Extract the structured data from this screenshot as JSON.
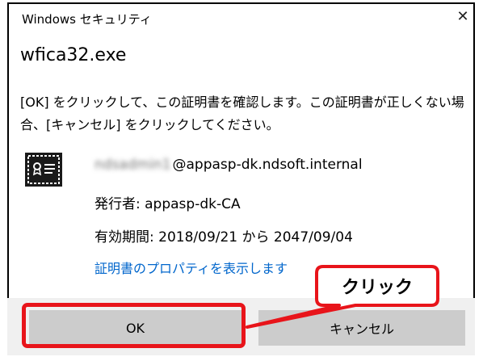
{
  "dialog": {
    "title": "Windows セキュリティ",
    "close_symbol": "✕",
    "app_name": "wfica32.exe",
    "message": "[OK] をクリックして、この証明書を確認します。この証明書が正しくない場合、[キャンセル] をクリックしてください。"
  },
  "certificate": {
    "icon": "certificate-icon",
    "user_blurred": "ndsadmin1",
    "user_domain": "@appasp-dk.ndsoft.internal",
    "issuer": "発行者: appasp-dk-CA",
    "validity": "有効期間: 2018/09/21 から 2047/09/04",
    "properties_link": "証明書のプロパティを表示します"
  },
  "buttons": {
    "ok_label": "OK",
    "cancel_label": "キャンセル"
  },
  "annotation": {
    "callout_label": "クリック",
    "color": "#e8141a"
  },
  "colors": {
    "link": "#0066cc",
    "button_bg": "#cccccc",
    "footer_bg": "#f0f0f0"
  }
}
